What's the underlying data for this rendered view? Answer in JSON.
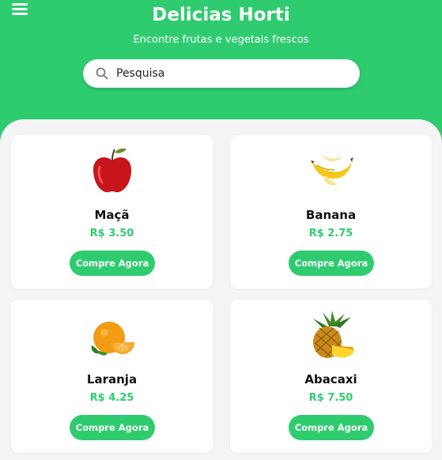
{
  "header": {
    "title": "Delicias Horti",
    "subtitle": "Encontre frutas e vegetais frescos",
    "menu_icon": "hamburger-menu-icon"
  },
  "search": {
    "placeholder": "Pesquisa",
    "value": "",
    "icon": "search-icon"
  },
  "colors": {
    "brand": "#2ecc6f",
    "background": "#f4f4f4",
    "card": "#ffffff"
  },
  "products": [
    {
      "name": "Maçã",
      "price": "R$ 3.50",
      "button": "Compre Agora",
      "image": "apple-image"
    },
    {
      "name": "Banana",
      "price": "R$ 2.75",
      "button": "Compre Agora",
      "image": "banana-image"
    },
    {
      "name": "Laranja",
      "price": "R$ 4.25",
      "button": "Compre Agora",
      "image": "orange-image"
    },
    {
      "name": "Abacaxi",
      "price": "R$ 7.50",
      "button": "Compre Agora",
      "image": "pineapple-image"
    }
  ]
}
